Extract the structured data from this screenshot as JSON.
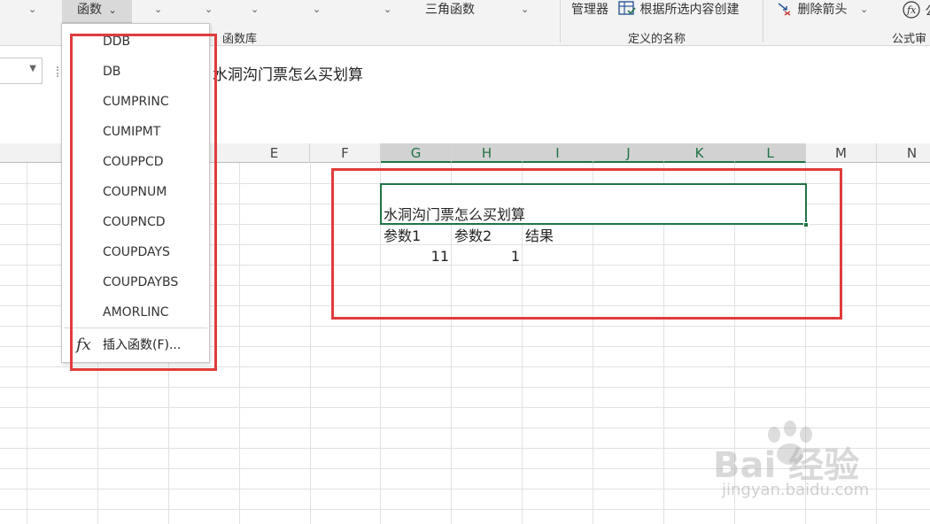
{
  "ribbon": {
    "function_button": "函数",
    "trig_label": "三角函数",
    "name_manager": "管理器",
    "create_from_selection": "根据所选内容创建",
    "remove_arrows": "删除箭头",
    "partial_formula": "公",
    "group_function_library": "函数库",
    "group_defined_names": "定义的名称",
    "group_formula_audit": "公式审"
  },
  "formula_bar": {
    "content": "水洞沟门票怎么买划算"
  },
  "columns": [
    "E",
    "F",
    "G",
    "H",
    "I",
    "J",
    "K",
    "L",
    "M",
    "N"
  ],
  "sheet": {
    "title_cell": "水洞沟门票怎么买划算",
    "header_param1": "参数1",
    "header_param2": "参数2",
    "header_result": "结果",
    "value_param1": "11",
    "value_param2": "1",
    "result_value": ""
  },
  "dropdown": {
    "items": [
      "DDB",
      "DB",
      "CUMPRINC",
      "CUMIPMT",
      "COUPPCD",
      "COUPNUM",
      "COUPNCD",
      "COUPDAYS",
      "COUPDAYBS",
      "AMORLINC"
    ],
    "insert_function": "插入函数(F)...",
    "fx_icon": "fx"
  },
  "watermark": {
    "logo": "Bai  经验",
    "url": "jingyan.baidu.com"
  },
  "colors": {
    "accent_green": "#217346",
    "highlight_red": "#e03c3c",
    "ribbon_bg": "#f3f3f3"
  }
}
